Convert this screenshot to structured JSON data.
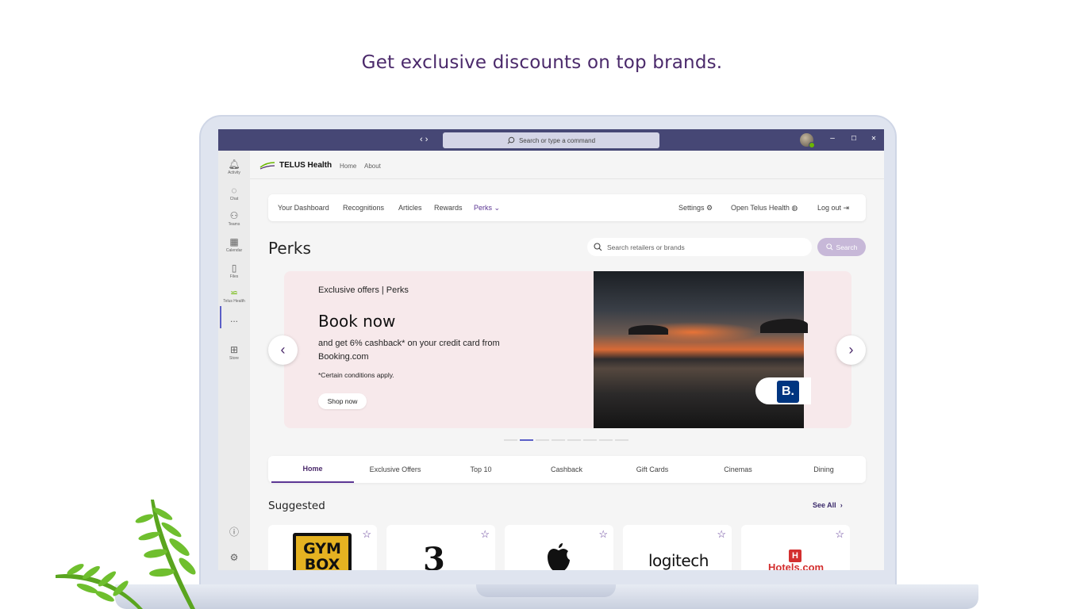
{
  "headline": "Get exclusive discounts on top brands.",
  "window": {
    "nav_arrows": "‹ ›",
    "command_search_placeholder": "Search or type a command",
    "controls": {
      "minimize": "–",
      "maximize": "☐",
      "close": "✕"
    }
  },
  "left_rail": {
    "items": [
      {
        "label": "Activity",
        "icon": "bell-icon"
      },
      {
        "label": "Chat",
        "icon": "chat-icon"
      },
      {
        "label": "Teams",
        "icon": "teams-icon"
      },
      {
        "label": "Calendar",
        "icon": "calendar-icon"
      },
      {
        "label": "Files",
        "icon": "file-icon"
      },
      {
        "label": "Telus Health",
        "icon": "telus-icon"
      },
      {
        "label": "...",
        "icon": "more-icon"
      },
      {
        "label": "Store",
        "icon": "store-icon"
      }
    ],
    "bottom": [
      {
        "icon": "help-icon"
      },
      {
        "icon": "gear-icon"
      }
    ]
  },
  "app_header": {
    "brand": "TELUS Health",
    "links": [
      "Home",
      "About"
    ]
  },
  "nav": {
    "left": [
      "Your Dashboard",
      "Recognitions",
      "Articles",
      "Rewards",
      "Perks"
    ],
    "active": "Perks",
    "settings": "Settings",
    "open_telus": "Open Telus Health",
    "logout": "Log out"
  },
  "page": {
    "title": "Perks",
    "search_placeholder": "Search retailers or brands",
    "search_button": "Search"
  },
  "banner": {
    "kicker": "Exclusive offers | Perks",
    "title": "Book now",
    "text": "and get 6% cashback* on your credit card from Booking.com",
    "note": "*Certain conditions apply.",
    "cta": "Shop now",
    "brand_logo": "B.",
    "slides_total": 8,
    "active_slide": 2
  },
  "tabs": [
    "Home",
    "Exclusive Offers",
    "Top 10",
    "Cashback",
    "Gift Cards",
    "Cinemas",
    "Dining"
  ],
  "active_tab": "Home",
  "suggested": {
    "title": "Suggested",
    "see_all": "See All",
    "brands": [
      {
        "name": "GYM BOX",
        "logo_text": "GYM BOX"
      },
      {
        "name": "Three",
        "logo_text": "3"
      },
      {
        "name": "Apple",
        "logo_text": ""
      },
      {
        "name": "logitech",
        "logo_text": "logitech"
      },
      {
        "name": "Hotels.com",
        "logo_text": "Hotels.com"
      }
    ]
  },
  "colors": {
    "headline": "#4b2a6b",
    "teams_titlebar": "#464775",
    "accent_purple": "#5c3694",
    "banner_bg": "#f7e9eb",
    "booking_blue": "#003580",
    "hotels_red": "#d32f2f"
  }
}
